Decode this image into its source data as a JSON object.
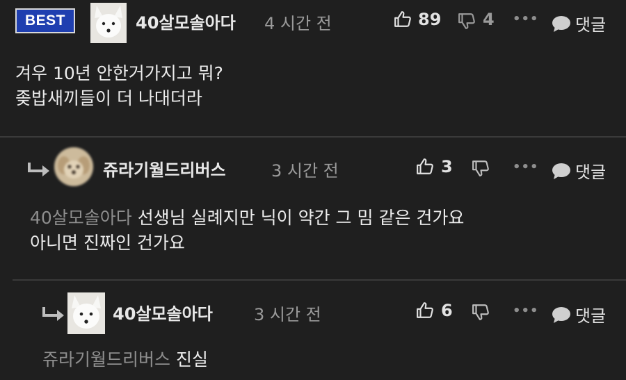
{
  "best_badge": "BEST",
  "comments": [
    {
      "username": "40살모솔아다",
      "time": "4 시간 전",
      "likes": "89",
      "dislikes": "4",
      "reply_label": "댓글",
      "lines": [
        "겨우 10년 안한거가지고 뭐?",
        "좆밥새끼들이 더 나대더라"
      ]
    },
    {
      "username": "쥬라기월드리버스",
      "time": "3 시간 전",
      "likes": "3",
      "reply_label": "댓글",
      "mention": "40살모솔아다",
      "lines": [
        "선생님 실례지만 닉이 약간 그 밈 같은 건가요",
        "아니면 진짜인 건가요"
      ]
    },
    {
      "username": "40살모솔아다",
      "time": "3 시간 전",
      "likes": "6",
      "reply_label": "댓글",
      "mention": "쥬라기월드리버스",
      "lines": [
        "진실"
      ]
    }
  ]
}
